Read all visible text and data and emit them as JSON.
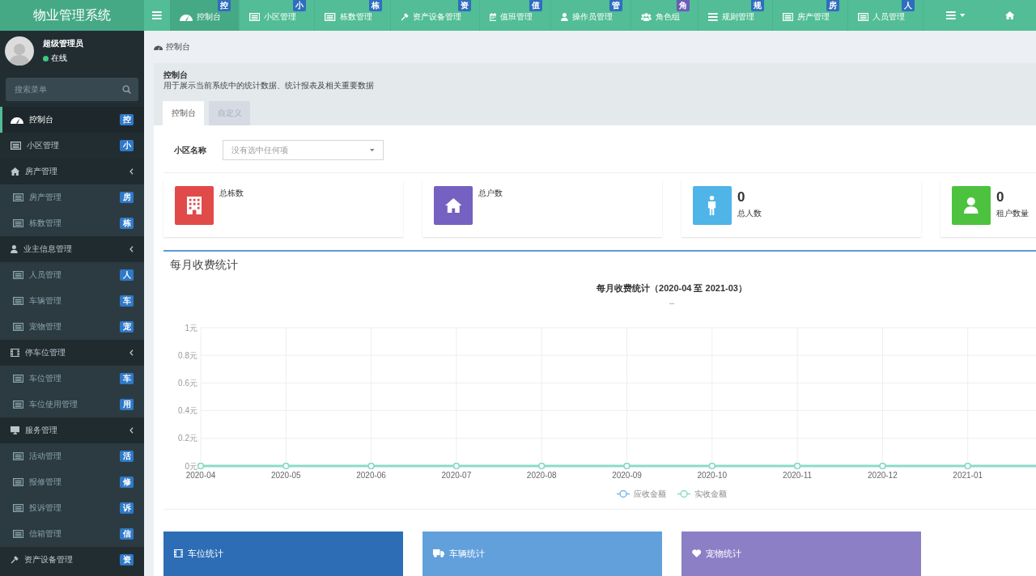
{
  "topbar": {
    "logo": "物业管理系统",
    "nav": [
      {
        "label": "控制台",
        "badge": {
          "text": "控",
          "color": "#2f6dbf"
        },
        "selected": true
      },
      {
        "label": "小区管理",
        "badge": {
          "text": "小",
          "color": "#2f6dbf"
        },
        "selected": false
      },
      {
        "label": "栋数管理",
        "badge": {
          "text": "栋",
          "color": "#2f6dbf"
        },
        "selected": false
      },
      {
        "label": "资产设备管理",
        "badge": {
          "text": "资",
          "color": "#2f6dbf"
        },
        "selected": false
      },
      {
        "label": "值班管理",
        "badge": {
          "text": "值",
          "color": "#2f6dbf"
        },
        "selected": false
      },
      {
        "label": "操作员管理",
        "badge": {
          "text": "管",
          "color": "#2f6dbf"
        },
        "selected": false
      },
      {
        "label": "角色组",
        "badge": {
          "text": "角",
          "color": "#6a5cb8"
        },
        "selected": false
      },
      {
        "label": "规则管理",
        "badge": {
          "text": "规",
          "color": "#2f6dbf"
        },
        "selected": false
      },
      {
        "label": "房产管理",
        "badge": {
          "text": "房",
          "color": "#2f6dbf"
        },
        "selected": false
      },
      {
        "label": "人员管理",
        "badge": {
          "text": "人",
          "color": "#2f6dbf"
        },
        "selected": false
      }
    ]
  },
  "sidebar": {
    "user": {
      "name": "超级管理员",
      "status": "在线"
    },
    "search": {
      "placeholder": "搜索菜单"
    },
    "items": [
      {
        "label": "控制台",
        "badge": "控",
        "selected": true
      },
      {
        "label": "小区管理",
        "badge": "小",
        "selected": false
      },
      {
        "label": "房产管理",
        "selected": false,
        "expanded": true,
        "children": [
          {
            "label": "房产管理",
            "badge": "房",
            "selected": false
          },
          {
            "label": "栋数管理",
            "badge": "栋",
            "selected": false
          }
        ]
      },
      {
        "label": "业主信息管理",
        "selected": false,
        "expanded": true,
        "children": [
          {
            "label": "人员管理",
            "badge": "人",
            "selected": false
          },
          {
            "label": "车辆管理",
            "badge": "车",
            "selected": false
          },
          {
            "label": "宠物管理",
            "badge": "宠",
            "selected": false
          }
        ]
      },
      {
        "label": "停车位管理",
        "selected": false,
        "expanded": true,
        "children": [
          {
            "label": "车位管理",
            "badge": "车",
            "selected": false
          },
          {
            "label": "车位使用管理",
            "badge": "用",
            "selected": false
          }
        ]
      },
      {
        "label": "服务管理",
        "selected": false,
        "expanded": true,
        "children": [
          {
            "label": "活动管理",
            "badge": "活",
            "selected": false
          },
          {
            "label": "报修管理",
            "badge": "修",
            "selected": false
          },
          {
            "label": "投诉管理",
            "badge": "诉",
            "selected": false
          },
          {
            "label": "信箱管理",
            "badge": "信",
            "selected": false
          }
        ]
      },
      {
        "label": "资产设备管理",
        "badge": "资",
        "selected": false
      }
    ]
  },
  "breadcrumb": {
    "label": "控制台"
  },
  "panel": {
    "title": "控制台",
    "description": "用于展示当前系统中的统计数据、统计报表及相关重要数据",
    "tabs": [
      {
        "label": "控制台",
        "selected": true
      },
      {
        "label": "自定义",
        "selected": false
      }
    ],
    "filter": {
      "label": "小区名称",
      "placeholder": "没有选中任何项"
    },
    "stats": [
      {
        "label": "总栋数",
        "color": "#e04b4a"
      },
      {
        "label": "总户数",
        "color": "#7461c1"
      },
      {
        "value": "0",
        "label": "总人数",
        "color": "#4fb4e7"
      },
      {
        "value": "0",
        "label": "租户数量",
        "color": "#4dc23f"
      }
    ],
    "chart_box": {
      "title": "每月收费统计",
      "subtitle": "--",
      "chart_data": {
        "type": "line",
        "title": "每月收费统计（2020-04 至 2021-03）",
        "categories": [
          "2020-04",
          "2020-05",
          "2020-06",
          "2020-07",
          "2020-08",
          "2020-09",
          "2020-10",
          "2020-11",
          "2020-12",
          "2021-01"
        ],
        "series": [
          {
            "name": "应收金额",
            "color": "#7cb5ec",
            "marker": "circle",
            "values": [
              0,
              0,
              0,
              0,
              0,
              0,
              0,
              0,
              0,
              0
            ]
          },
          {
            "name": "实收金额",
            "color": "#86dfbf",
            "marker": "circle",
            "values": [
              0,
              0,
              0,
              0,
              0,
              0,
              0,
              0,
              0,
              0
            ]
          }
        ],
        "ylim": [
          0,
          1
        ],
        "yticks": [
          {
            "value": 0,
            "label": "0元"
          },
          {
            "value": 0.2,
            "label": "0.2元"
          },
          {
            "value": 0.4,
            "label": "0.4元"
          },
          {
            "value": 0.6,
            "label": "0.6元"
          },
          {
            "value": 0.8,
            "label": "0.8元"
          },
          {
            "value": 1,
            "label": "1元"
          }
        ],
        "grid": true,
        "legend": "bottom"
      }
    },
    "bottom_cards": [
      {
        "label": "车位统计",
        "color": "#2d6db5"
      },
      {
        "label": "车辆统计",
        "color": "#62a0dc"
      },
      {
        "label": "宠物统计",
        "color": "#8c7fc6"
      }
    ]
  }
}
